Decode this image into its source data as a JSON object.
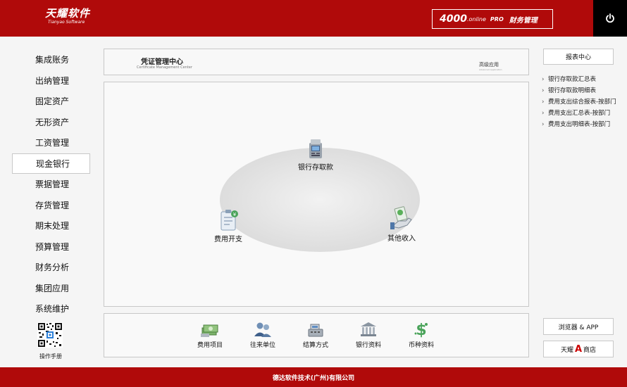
{
  "header": {
    "logo_main": "天耀软件",
    "logo_sub": "Tianyao Software",
    "product_number": "4000",
    "product_online": ".online",
    "product_pro": "PRO",
    "product_name": "财务管理",
    "power_icon": "power-icon",
    "brand_color": "#b00a0a"
  },
  "sidebar": {
    "items": [
      {
        "label": "集成账务",
        "active": false
      },
      {
        "label": "出纳管理",
        "active": false
      },
      {
        "label": "固定资产",
        "active": false
      },
      {
        "label": "无形资产",
        "active": false
      },
      {
        "label": "工资管理",
        "active": false
      },
      {
        "label": "现金银行",
        "active": true
      },
      {
        "label": "票据管理",
        "active": false
      },
      {
        "label": "存货管理",
        "active": false
      },
      {
        "label": "期末处理",
        "active": false
      },
      {
        "label": "预算管理",
        "active": false
      },
      {
        "label": "财务分析",
        "active": false
      },
      {
        "label": "集团应用",
        "active": false
      },
      {
        "label": "系统维护",
        "active": false
      }
    ],
    "manual_label": "操作手册"
  },
  "panel_header": {
    "title": "凭证管理中心",
    "subtitle": "Certificate Management Center",
    "right_title": "高级应用",
    "right_subtitle": "Advanced Application"
  },
  "flow": {
    "bank_deposit": "银行存取款",
    "expense": "费用开支",
    "other_income": "其他收入"
  },
  "bottom_bar": {
    "items": [
      {
        "label": "费用项目",
        "icon": "money-stack-icon"
      },
      {
        "label": "往来单位",
        "icon": "people-icon"
      },
      {
        "label": "结算方式",
        "icon": "cash-register-icon"
      },
      {
        "label": "银行资料",
        "icon": "bank-icon"
      },
      {
        "label": "币种资料",
        "icon": "dollar-icon"
      }
    ]
  },
  "right_panel": {
    "report_center": "报表中心",
    "reports": [
      "银行存取款汇总表",
      "银行存取款明细表",
      "费用支出综合报表-按部门",
      "费用支出汇总表-按部门",
      "费用支出明细表-按部门"
    ],
    "browser_app": "浏览器 & APP",
    "store_prefix": "天耀",
    "store_letter": "A",
    "store_suffix": "商店"
  },
  "footer": {
    "text": "德达软件技术(广州)有限公司"
  }
}
